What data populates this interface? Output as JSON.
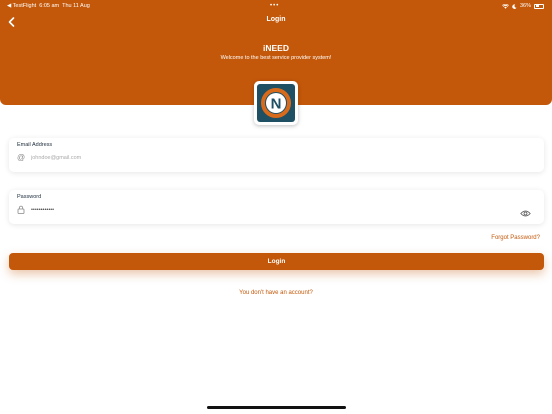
{
  "status_bar": {
    "carrier": "◀ TestFlight",
    "time": "6:05 am",
    "date": "Thu 11 Aug",
    "dots": "•••",
    "battery": "36%"
  },
  "nav": {
    "title": "Login"
  },
  "header": {
    "app_name": "iNEED",
    "subtitle": "Welcome to the best service provider system!",
    "logo_letter": "N"
  },
  "form": {
    "email": {
      "label": "Email Address",
      "placeholder": "johndoe@gmail.com",
      "icon": "at-icon"
    },
    "password": {
      "label": "Password",
      "value": "••••••••••••",
      "icon": "lock-icon",
      "toggle_icon": "eye-icon"
    },
    "forgot_password": "Forgot Password?",
    "login_button": "Login",
    "signup_prompt": "You don't have an account?"
  },
  "colors": {
    "accent": "#c4580a",
    "logo_background": "#1e4f63"
  }
}
